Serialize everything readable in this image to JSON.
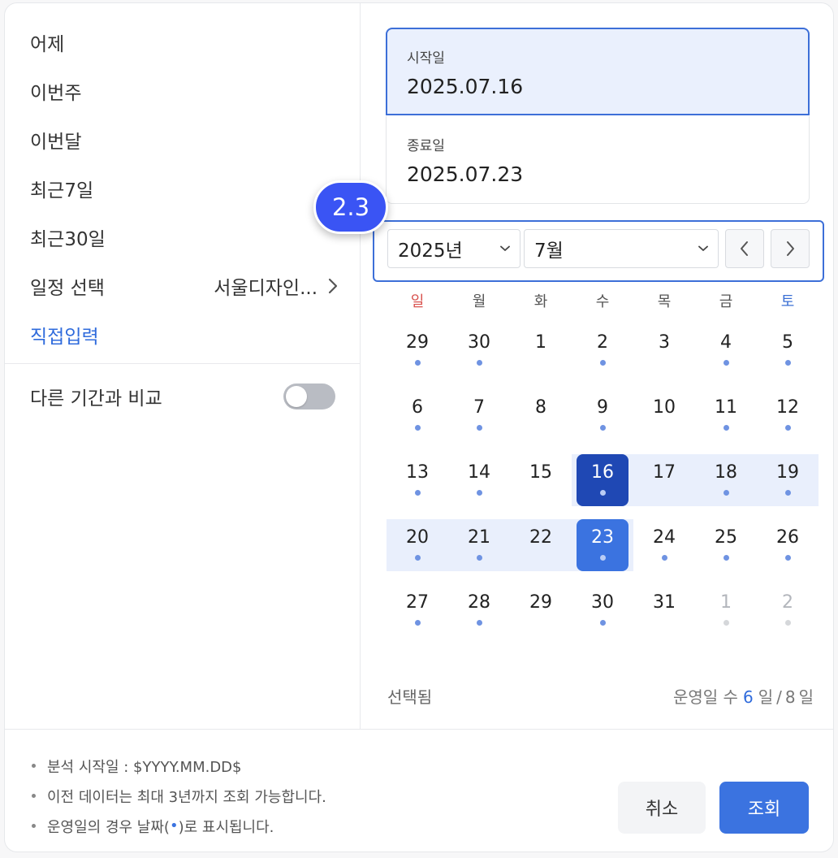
{
  "presets": [
    {
      "label": "어제",
      "value": ""
    },
    {
      "label": "이번주",
      "value": ""
    },
    {
      "label": "이번달",
      "value": ""
    },
    {
      "label": "최근7일",
      "value": ""
    },
    {
      "label": "최근30일",
      "value": ""
    },
    {
      "label": "일정 선택",
      "value": "서울디자인..."
    },
    {
      "label": "직접입력",
      "value": ""
    }
  ],
  "compare": {
    "label": "다른 기간과 비교",
    "enabled": false
  },
  "start": {
    "label": "시작일",
    "value": "2025.07.16"
  },
  "end": {
    "label": "종료일",
    "value": "2025.07.23"
  },
  "badge": "2.3",
  "year_select": "2025년",
  "month_select": "7월",
  "weekdays": [
    "일",
    "월",
    "화",
    "수",
    "목",
    "금",
    "토"
  ],
  "weeks": [
    [
      {
        "d": "29",
        "dot": true,
        "other": false
      },
      {
        "d": "30",
        "dot": true,
        "other": false
      },
      {
        "d": "1",
        "dot": false,
        "other": false
      },
      {
        "d": "2",
        "dot": true,
        "other": false
      },
      {
        "d": "3",
        "dot": false,
        "other": false
      },
      {
        "d": "4",
        "dot": true,
        "other": false
      },
      {
        "d": "5",
        "dot": true,
        "other": false
      }
    ],
    [
      {
        "d": "6",
        "dot": true,
        "other": false
      },
      {
        "d": "7",
        "dot": true,
        "other": false
      },
      {
        "d": "8",
        "dot": false,
        "other": false
      },
      {
        "d": "9",
        "dot": true,
        "other": false
      },
      {
        "d": "10",
        "dot": false,
        "other": false
      },
      {
        "d": "11",
        "dot": true,
        "other": false
      },
      {
        "d": "12",
        "dot": true,
        "other": false
      }
    ],
    [
      {
        "d": "13",
        "dot": true,
        "other": false
      },
      {
        "d": "14",
        "dot": true,
        "other": false
      },
      {
        "d": "15",
        "dot": false,
        "other": false
      },
      {
        "d": "16",
        "dot": true,
        "other": false,
        "state": "start"
      },
      {
        "d": "17",
        "dot": false,
        "other": false
      },
      {
        "d": "18",
        "dot": true,
        "other": false
      },
      {
        "d": "19",
        "dot": true,
        "other": false
      }
    ],
    [
      {
        "d": "20",
        "dot": true,
        "other": false
      },
      {
        "d": "21",
        "dot": true,
        "other": false
      },
      {
        "d": "22",
        "dot": false,
        "other": false
      },
      {
        "d": "23",
        "dot": true,
        "other": false,
        "state": "end"
      },
      {
        "d": "24",
        "dot": true,
        "other": false
      },
      {
        "d": "25",
        "dot": true,
        "other": false
      },
      {
        "d": "26",
        "dot": true,
        "other": false
      }
    ],
    [
      {
        "d": "27",
        "dot": true,
        "other": false
      },
      {
        "d": "28",
        "dot": true,
        "other": false
      },
      {
        "d": "29",
        "dot": false,
        "other": false
      },
      {
        "d": "30",
        "dot": true,
        "other": false
      },
      {
        "d": "31",
        "dot": false,
        "other": false
      },
      {
        "d": "1",
        "dot": true,
        "other": true
      },
      {
        "d": "2",
        "dot": true,
        "other": true
      }
    ]
  ],
  "footer": {
    "selected_label": "선택됨",
    "count_prefix": "운영일 수",
    "count_selected": "6",
    "count_unit1": "일",
    "count_sep": "/",
    "count_total": "8",
    "count_unit2": "일"
  },
  "notes": [
    {
      "pre": "분석 시작일 : $YYYY.MM.DD$",
      "dot": "",
      "post": ""
    },
    {
      "pre": "이전 데이터는 최대 3년까지 조회 가능합니다.",
      "dot": "",
      "post": ""
    },
    {
      "pre": "운영일의 경우 날짜(",
      "dot": "•",
      "post": ")로 표시됩니다."
    }
  ],
  "buttons": {
    "cancel": "취소",
    "confirm": "조회"
  },
  "colors": {
    "accent": "#3b73e0",
    "range": "#e9effc",
    "start": "#1f48b4",
    "badge": "#3a54f4",
    "sunday": "#d9534f",
    "saturday": "#3b6fd4"
  }
}
